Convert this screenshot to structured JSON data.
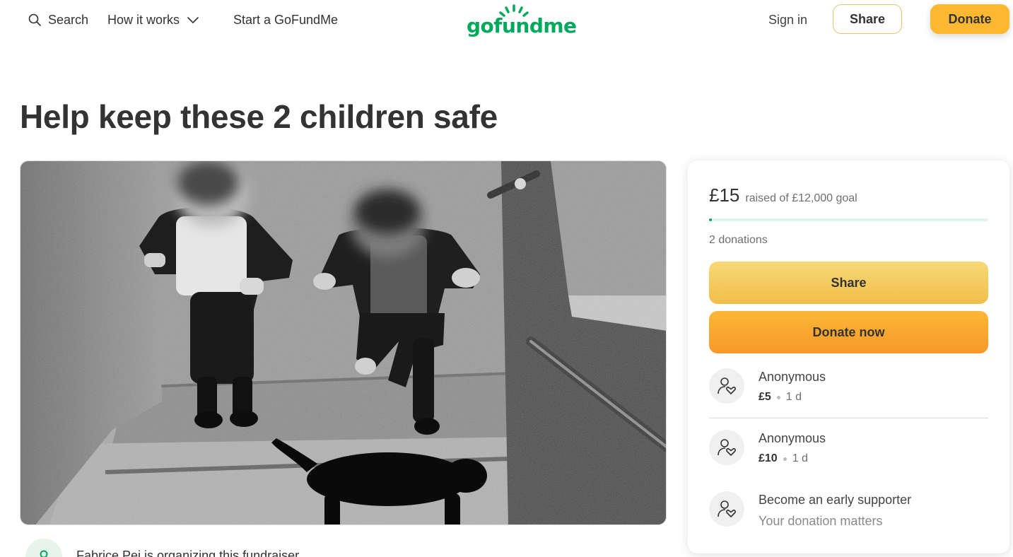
{
  "nav": {
    "search_label": "Search",
    "how_label": "How it works",
    "start_label": "Start a GoFundMe",
    "logo_text": "gofundme",
    "signin_label": "Sign in",
    "share_label": "Share",
    "donate_label": "Donate"
  },
  "page": {
    "title": "Help keep these 2 children safe"
  },
  "organizer": {
    "text": "Fabrice Pei is organizing this fundraiser"
  },
  "card": {
    "raised_amount": "£15",
    "raised_goal": "raised of £12,000 goal",
    "progress_fraction": 0.00125,
    "donation_count": "2 donations",
    "share_label": "Share",
    "donate_label": "Donate now",
    "donations": [
      {
        "name": "Anonymous",
        "amount": "£5",
        "time": "1 d"
      },
      {
        "name": "Anonymous",
        "amount": "£10",
        "time": "1 d"
      }
    ],
    "supporter": {
      "title": "Become an early supporter",
      "subtitle": "Your donation matters"
    }
  },
  "colors": {
    "brand_green": "#02a95c",
    "donate_orange": "#fbb830",
    "text_dark": "#333333"
  },
  "icons": [
    "search-icon",
    "chevron-down-icon",
    "donor-heart-icon",
    "organizer-icon"
  ]
}
